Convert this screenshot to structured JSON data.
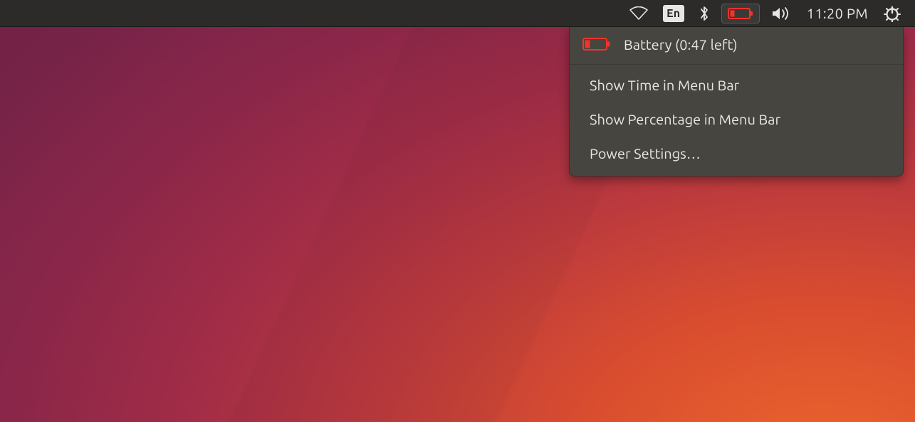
{
  "topbar": {
    "language_label": "En",
    "clock": "11:20 PM"
  },
  "battery_menu": {
    "status_label": "Battery (0:47 left)",
    "items": [
      {
        "label": "Show Time in Menu Bar"
      },
      {
        "label": "Show Percentage in Menu Bar"
      },
      {
        "label": "Power Settings…"
      }
    ]
  },
  "colors": {
    "battery_critical": "#f3322a"
  }
}
